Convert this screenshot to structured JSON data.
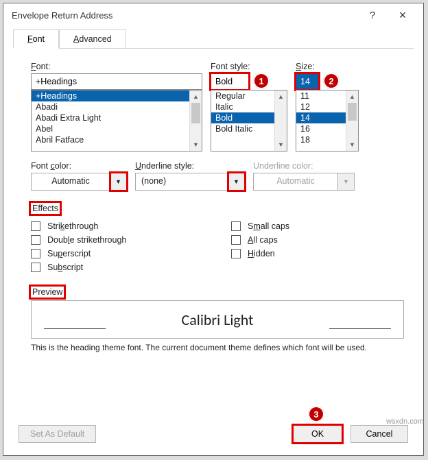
{
  "window": {
    "title": "Envelope Return Address",
    "help": "?",
    "close": "×"
  },
  "tabs": {
    "font": "Font",
    "advanced": "Advanced"
  },
  "labels": {
    "font": "Font:",
    "font_style": "Font style:",
    "size": "Size:",
    "font_color": "Font color:",
    "underline_style": "Underline style:",
    "underline_color": "Underline color:",
    "effects": "Effects",
    "preview": "Preview"
  },
  "inputs": {
    "font_value": "+Headings",
    "style_value": "Bold",
    "size_value": "14",
    "font_color_value": "Automatic",
    "underline_style_value": "(none)",
    "underline_color_value": "Automatic"
  },
  "lists": {
    "fonts": [
      "+Headings",
      "Abadi",
      "Abadi Extra Light",
      "Abel",
      "Abril Fatface"
    ],
    "styles": [
      "Regular",
      "Italic",
      "Bold",
      "Bold Italic"
    ],
    "sizes": [
      "11",
      "12",
      "14",
      "16",
      "18"
    ]
  },
  "effects": {
    "strikethrough": "Strikethrough",
    "double_strikethrough": "Double strikethrough",
    "superscript": "Superscript",
    "subscript": "Subscript",
    "small_caps": "Small caps",
    "all_caps": "All caps",
    "hidden": "Hidden"
  },
  "preview": {
    "text": "Calibri Light",
    "hint": "This is the heading theme font. The current document theme defines which font will be used."
  },
  "buttons": {
    "set_default": "Set As Default",
    "ok": "OK",
    "cancel": "Cancel"
  },
  "annotations": {
    "a1": "1",
    "a2": "2",
    "a3": "3"
  },
  "watermark": "wsxdn.com"
}
